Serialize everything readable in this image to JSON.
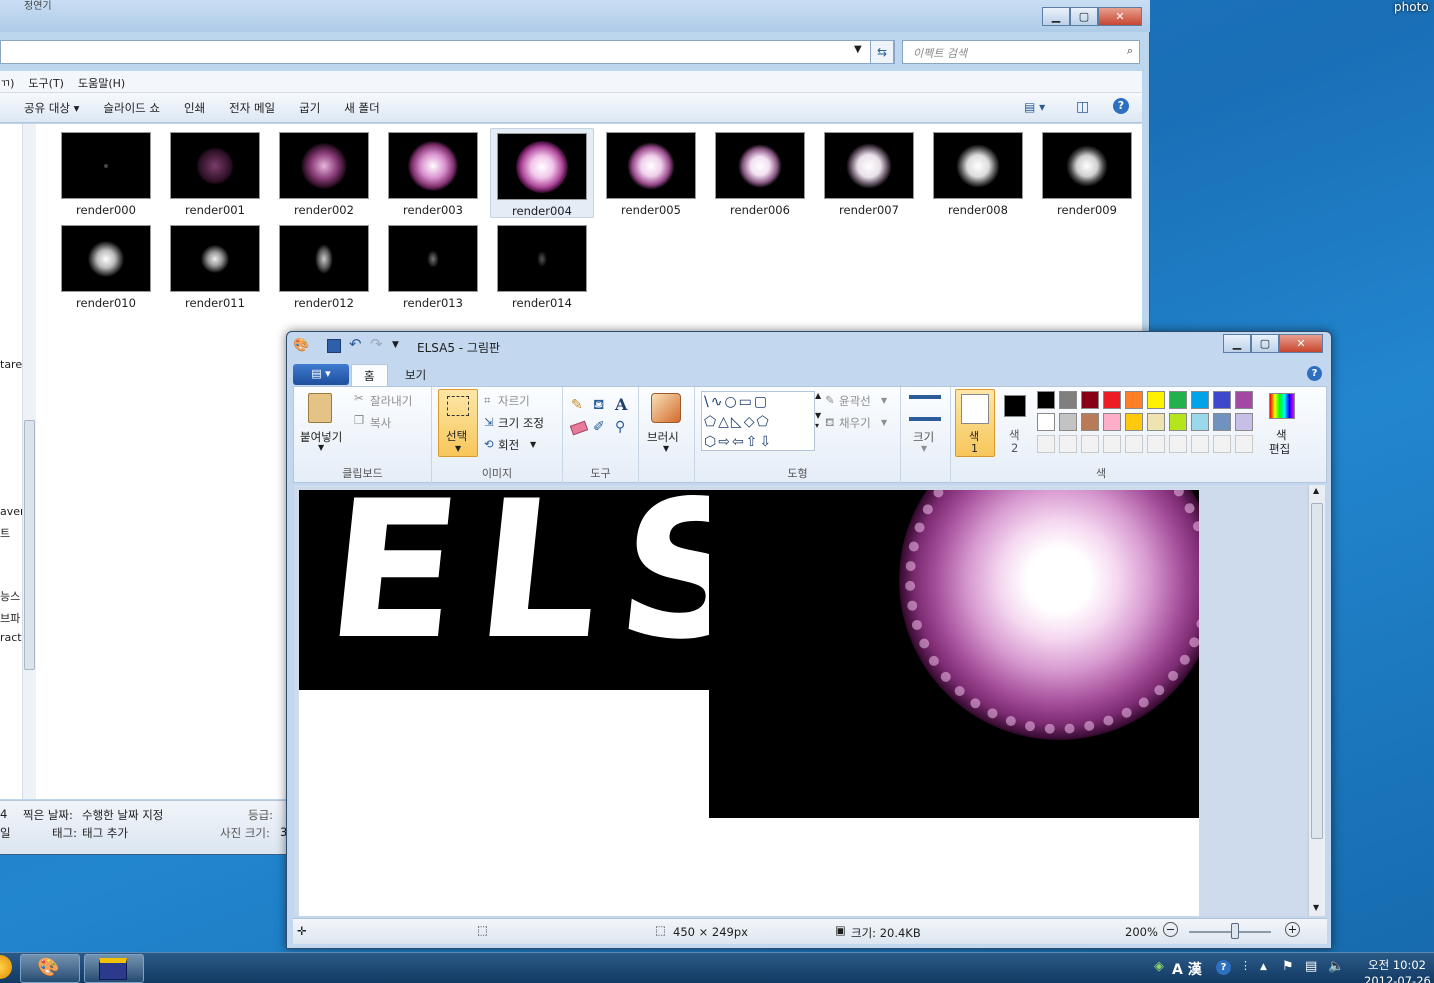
{
  "desktop": {
    "corner_label": "photo"
  },
  "explorer": {
    "title": "정연기",
    "search_placeholder": "이펙트 검색",
    "menu": [
      "ㄲ)",
      "도구(T)",
      "도움말(H)"
    ],
    "commands": [
      "공유 대상 ▾",
      "슬라이드 쇼",
      "인쇄",
      "전자 메일",
      "굽기",
      "새 폴더"
    ],
    "nav_fragments": [
      "tarea",
      "aver",
      "트",
      "능스",
      "브파",
      "ract"
    ],
    "files": [
      "render000",
      "render001",
      "render002",
      "render003",
      "render004",
      "render005",
      "render006",
      "render007",
      "render008",
      "render009",
      "render010",
      "render011",
      "render012",
      "render013",
      "render014"
    ],
    "selected_file": "render004",
    "details": {
      "date_label": "찍은 날짜:",
      "date_value": "수행한 날짜 지정",
      "tag_label": "태그:",
      "tag_value": "태그 추가",
      "rating_label": "등급:",
      "size_label": "사진 크기:",
      "size_value": "3",
      "left_frag1": "4",
      "left_frag2": "일"
    }
  },
  "paint": {
    "title": "ELSA5 - 그림판",
    "tabs": {
      "home": "홈",
      "view": "보기"
    },
    "clipboard": {
      "paste": "붙여넣기",
      "cut": "잘라내기",
      "copy": "복사",
      "label": "클립보드"
    },
    "image": {
      "select": "선택",
      "crop": "자르기",
      "resize": "크기 조정",
      "rotate": "회전",
      "label": "이미지"
    },
    "tools": {
      "label": "도구"
    },
    "brush": {
      "label": "브러시"
    },
    "shapes": {
      "outline": "윤곽선",
      "fill": "채우기",
      "label": "도형"
    },
    "size": {
      "label": "크기"
    },
    "color1": {
      "line1": "색",
      "line2": "1"
    },
    "color2": {
      "line1": "색",
      "line2": "2"
    },
    "palette_row1": [
      "#000000",
      "#7f7f7f",
      "#880015",
      "#ed1c24",
      "#ff7f27",
      "#fff200",
      "#22b14c",
      "#00a2e8",
      "#3f48cc",
      "#a349a4"
    ],
    "palette_row2": [
      "#ffffff",
      "#c3c3c3",
      "#b97a57",
      "#ffaec9",
      "#ffc90e",
      "#efe4b0",
      "#b5e61d",
      "#99d9ea",
      "#7092be",
      "#c8bfe7"
    ],
    "colors": {
      "label": "색",
      "edit1": "색",
      "edit2": "편집"
    },
    "canvas_text": "ELS",
    "status": {
      "dimensions": "450 × 249px",
      "filesize": "크기: 20.4KB",
      "zoom": "200%"
    }
  },
  "taskbar": {
    "clock_time": "오전 10:02",
    "clock_date": "2012-07-26",
    "ime": "A 漢"
  }
}
